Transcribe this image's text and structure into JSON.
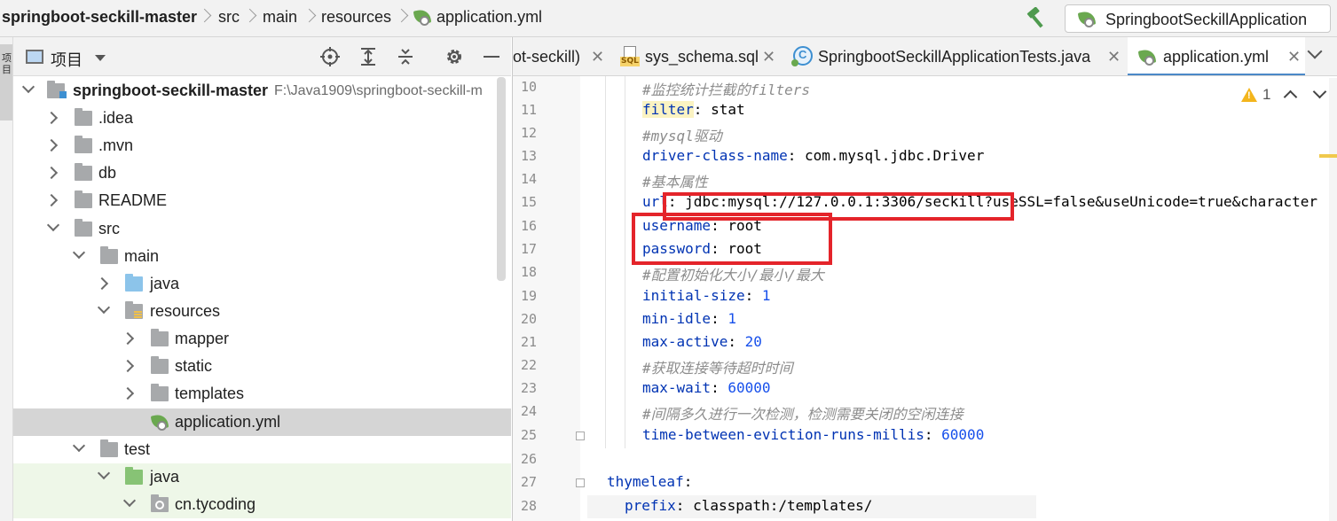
{
  "breadcrumb": {
    "project": "springboot-seckill-master",
    "items": [
      "src",
      "main",
      "resources",
      "application.yml"
    ]
  },
  "run_config": {
    "label": "SpringbootSeckillApplication"
  },
  "left_strip": {
    "label": "项目"
  },
  "project_panel": {
    "title": "项目",
    "tree": [
      {
        "label": "springboot-seckill-master",
        "path": "F:\\Java1909\\springboot-seckill-m"
      },
      {
        "label": ".idea"
      },
      {
        "label": ".mvn"
      },
      {
        "label": "db"
      },
      {
        "label": "README"
      },
      {
        "label": "src"
      },
      {
        "label": "main"
      },
      {
        "label": "java"
      },
      {
        "label": "resources"
      },
      {
        "label": "mapper"
      },
      {
        "label": "static"
      },
      {
        "label": "templates"
      },
      {
        "label": "application.yml"
      },
      {
        "label": "test"
      },
      {
        "label": "java"
      },
      {
        "label": "cn.tycoding"
      }
    ]
  },
  "editor_tabs": [
    {
      "label": "ot-seckill)"
    },
    {
      "label": "sys_schema.sql"
    },
    {
      "label": "SpringbootSeckillApplicationTests.java"
    },
    {
      "label": "application.yml"
    }
  ],
  "tab_close": "✕",
  "warnings": {
    "count": "1"
  },
  "code": {
    "l10": {
      "num": "10",
      "text": "#监控统计拦截的filters"
    },
    "l11": {
      "num": "11",
      "key": "filter",
      "val": ": stat"
    },
    "l12": {
      "num": "12",
      "text": "#mysql驱动"
    },
    "l13": {
      "num": "13",
      "key": "driver-class-name",
      "val": ": com.mysql.jdbc.Driver"
    },
    "l14": {
      "num": "14",
      "text": "#基本属性"
    },
    "l15": {
      "num": "15",
      "key": "url",
      "val": ": jdbc:mysql://127.0.0.1:3306/seckill?useSSL=false&useUnicode=true&character"
    },
    "l16": {
      "num": "16",
      "key": "username",
      "val": ": root"
    },
    "l17": {
      "num": "17",
      "key": "password",
      "val": ": root"
    },
    "l18": {
      "num": "18",
      "text": "#配置初始化大小/最小/最大"
    },
    "l19": {
      "num": "19",
      "key": "initial-size",
      "sep": ": ",
      "numval": "1"
    },
    "l20": {
      "num": "20",
      "key": "min-idle",
      "sep": ": ",
      "numval": "1"
    },
    "l21": {
      "num": "21",
      "key": "max-active",
      "sep": ": ",
      "numval": "20"
    },
    "l22": {
      "num": "22",
      "text": "#获取连接等待超时时间"
    },
    "l23": {
      "num": "23",
      "key": "max-wait",
      "sep": ": ",
      "numval": "60000"
    },
    "l24": {
      "num": "24",
      "text": "#间隔多久进行一次检测，检测需要关闭的空闲连接"
    },
    "l25": {
      "num": "25",
      "key": "time-between-eviction-runs-millis",
      "sep": ": ",
      "numval": "60000"
    },
    "l26": {
      "num": "26"
    },
    "l27": {
      "num": "27",
      "key": "thymeleaf",
      "val": ":"
    },
    "l28": {
      "num": "28",
      "key": "prefix",
      "val": ": classpath:/templates/"
    }
  },
  "colors": {
    "highlight_box": "#e4242a",
    "key": "#0033b3",
    "number": "#1750eb",
    "comment": "#8c8c8c"
  }
}
